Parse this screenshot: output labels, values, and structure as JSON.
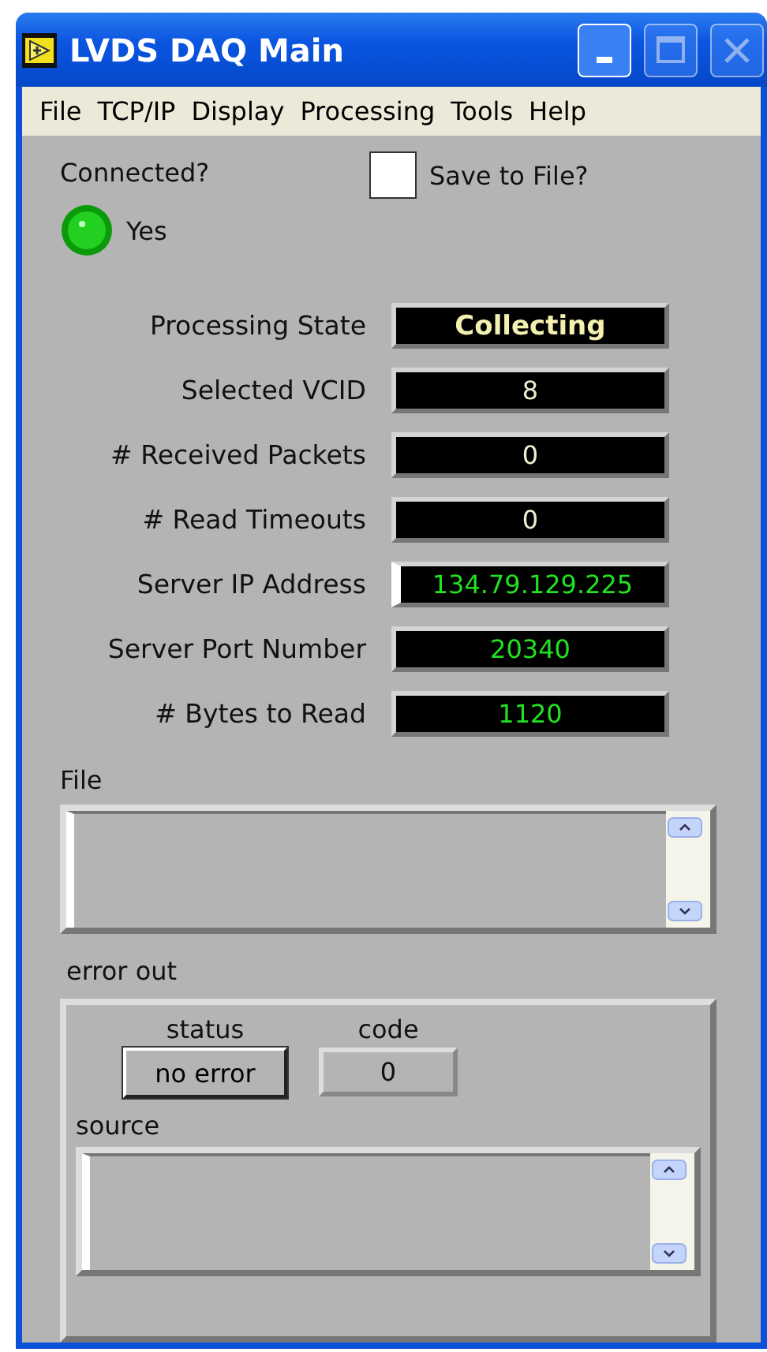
{
  "window": {
    "title": "LVDS DAQ Main"
  },
  "menu": [
    "File",
    "TCP/IP",
    "Display",
    "Processing",
    "Tools",
    "Help"
  ],
  "connected": {
    "label": "Connected?",
    "on": true,
    "text": "Yes"
  },
  "save_to_file": {
    "label": "Save to File?",
    "checked": false
  },
  "fields": [
    {
      "label": "Processing State",
      "value": "Collecting",
      "kind": "state"
    },
    {
      "label": "Selected VCID",
      "value": "8",
      "kind": "indicator"
    },
    {
      "label": "# Received Packets",
      "value": "0",
      "kind": "indicator"
    },
    {
      "label": "# Read Timeouts",
      "value": "0",
      "kind": "indicator"
    },
    {
      "label": "Server IP Address",
      "value": "134.79.129.225",
      "kind": "control"
    },
    {
      "label": "Server Port Number",
      "value": "20340",
      "kind": "numeric"
    },
    {
      "label": "# Bytes to Read",
      "value": "1120",
      "kind": "numeric"
    }
  ],
  "file": {
    "label": "File"
  },
  "error_out": {
    "label": "error out",
    "status_label": "status",
    "status": "no error",
    "code_label": "code",
    "code": "0",
    "source_label": "source"
  }
}
